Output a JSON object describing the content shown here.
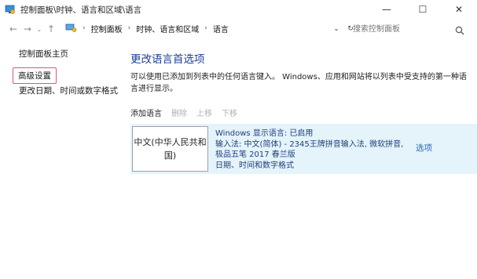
{
  "window": {
    "title": "控制面板\\时钟、语言和区域\\语言",
    "minimize_glyph": "—",
    "maximize_glyph": "☐",
    "close_glyph": "✕"
  },
  "nav": {
    "back_glyph": "←",
    "forward_glyph": "→",
    "recent_glyph": "⌄",
    "up_glyph": "↑",
    "breadcrumb": [
      "控制面板",
      "时钟、语言和区域",
      "语言"
    ],
    "separator": "›",
    "dropdown_glyph": "⌄",
    "refresh_glyph": "↻",
    "search_placeholder": "搜索控制面板"
  },
  "sidebar": {
    "home": "控制面板主页",
    "advanced": "高级设置",
    "date_format": "更改日期、时间或数字格式"
  },
  "main": {
    "heading": "更改语言首选项",
    "description": "可以使用已添加到列表中的任何语言键入。 Windows、应用和网站将以列表中受支持的第一种语言进行显示。",
    "toolbar": {
      "add": "添加语言",
      "remove": "删除",
      "move_up": "上移",
      "move_down": "下移"
    },
    "language": {
      "name": "中文(中华人民共和国)",
      "display_language": "Windows 显示语言: 已启用",
      "input_method": "输入法: 中文(简体) - 2345王牌拼音输入法, 微软拼音, 极品五笔 2017 春兰版",
      "date_format": "日期、时间和数字格式",
      "options": "选项"
    }
  }
}
